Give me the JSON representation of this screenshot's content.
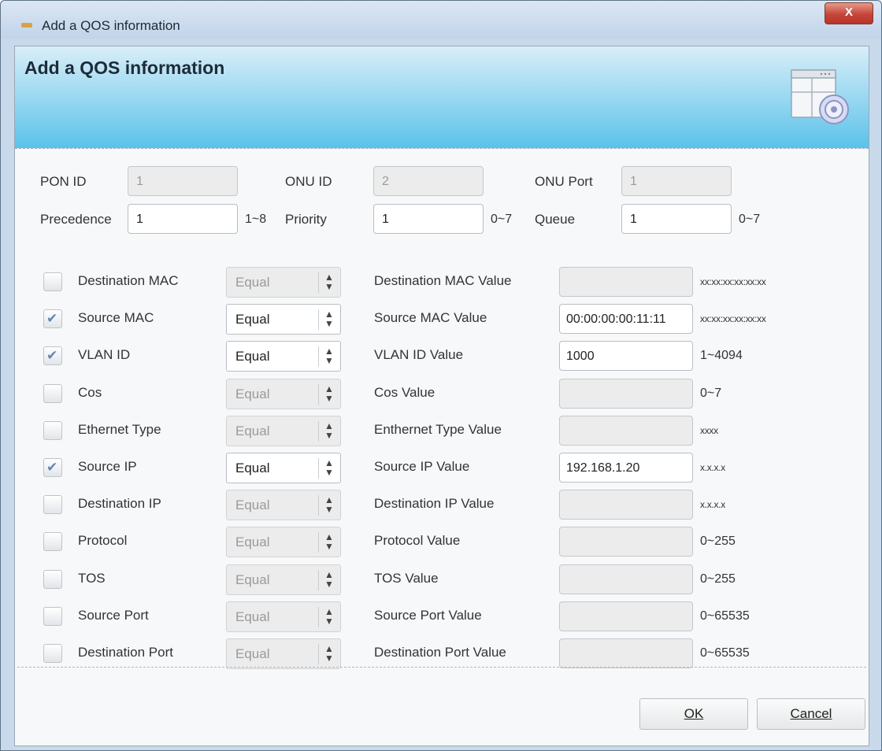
{
  "window": {
    "title": "Add a QOS information",
    "close_glyph": "X"
  },
  "banner": {
    "heading": "Add a QOS information",
    "icon": "settings-dialog-icon"
  },
  "top_fields": {
    "pon_id": {
      "label": "PON ID",
      "value": "1"
    },
    "onu_id": {
      "label": "ONU ID",
      "value": "2"
    },
    "onu_port": {
      "label": "ONU Port",
      "value": "1"
    },
    "precedence": {
      "label": "Precedence",
      "value": "1",
      "range": "1~8"
    },
    "priority": {
      "label": "Priority",
      "value": "1",
      "range": "0~7"
    },
    "queue": {
      "label": "Queue",
      "value": "1",
      "range": "0~7"
    }
  },
  "rules": [
    {
      "name": "Destination MAC",
      "checked": false,
      "operator": "Equal",
      "value_label": "Destination MAC Value",
      "value": "",
      "hint": "xx:xx:xx:xx:xx:xx"
    },
    {
      "name": "Source MAC",
      "checked": true,
      "operator": "Equal",
      "value_label": "Source MAC Value",
      "value": "00:00:00:00:11:11",
      "hint": "xx:xx:xx:xx:xx:xx"
    },
    {
      "name": "VLAN ID",
      "checked": true,
      "operator": "Equal",
      "value_label": "VLAN ID Value",
      "value": "1000",
      "hint": "1~4094"
    },
    {
      "name": "Cos",
      "checked": false,
      "operator": "Equal",
      "value_label": "Cos Value",
      "value": "",
      "hint": "0~7"
    },
    {
      "name": "Ethernet Type",
      "checked": false,
      "operator": "Equal",
      "value_label": "Enthernet Type Value",
      "value": "",
      "hint": "xxxx"
    },
    {
      "name": "Source IP",
      "checked": true,
      "operator": "Equal",
      "value_label": "Source IP Value",
      "value": "192.168.1.20",
      "hint": "x.x.x.x"
    },
    {
      "name": "Destination IP",
      "checked": false,
      "operator": "Equal",
      "value_label": "Destination IP Value",
      "value": "",
      "hint": "x.x.x.x"
    },
    {
      "name": "Protocol",
      "checked": false,
      "operator": "Equal",
      "value_label": "Protocol Value",
      "value": "",
      "hint": "0~255"
    },
    {
      "name": "TOS",
      "checked": false,
      "operator": "Equal",
      "value_label": "TOS Value",
      "value": "",
      "hint": "0~255"
    },
    {
      "name": "Source Port",
      "checked": false,
      "operator": "Equal",
      "value_label": "Source Port Value",
      "value": "",
      "hint": "0~65535"
    },
    {
      "name": "Destination Port",
      "checked": false,
      "operator": "Equal",
      "value_label": "Destination Port Value",
      "value": "",
      "hint": "0~65535"
    }
  ],
  "buttons": {
    "ok": "OK",
    "cancel": "Cancel"
  },
  "colors": {
    "banner_top": "#d9eef8",
    "banner_bottom": "#5bc2ea",
    "close_red": "#c6453a",
    "check_blue": "#5f87b6"
  }
}
